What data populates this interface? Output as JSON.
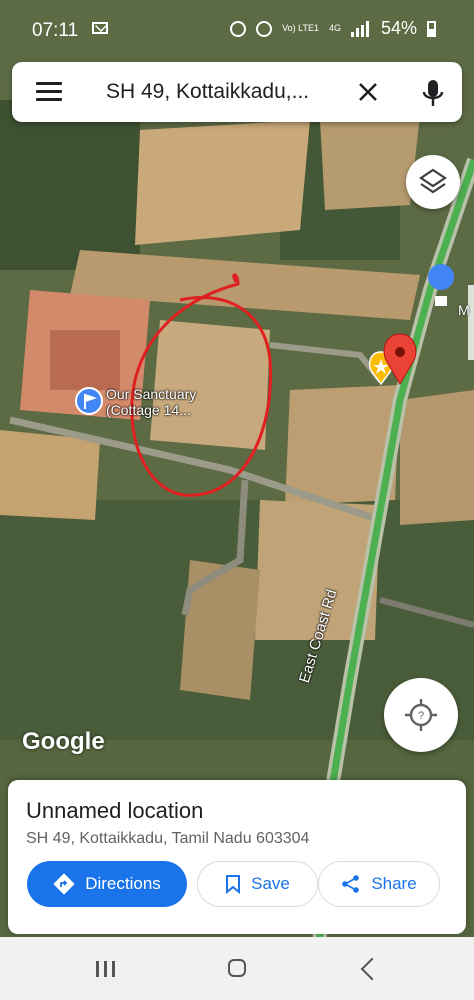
{
  "status_bar": {
    "time": "07:11",
    "network_label": "Vo) LTE1",
    "network_type": "4G",
    "battery": "54%"
  },
  "search": {
    "query": "SH 49, Kottaikkadu,..."
  },
  "map": {
    "place_label_line1": "Our Sanctuary",
    "place_label_line2": "(Cottage 14...",
    "road_label": "East Coast Rd",
    "partial_label": "M",
    "logo": "Google",
    "colors": {
      "route_highlight": "#4caf50",
      "drawn_circle": "#e02020",
      "pin_red": "#ea4335",
      "pin_blue": "#4285f4",
      "pin_yellow": "#fbbc04"
    }
  },
  "place": {
    "title": "Unnamed location",
    "address": "SH 49, Kottaikkadu, Tamil Nadu 603304"
  },
  "actions": {
    "directions": "Directions",
    "save": "Save",
    "share": "Share"
  }
}
